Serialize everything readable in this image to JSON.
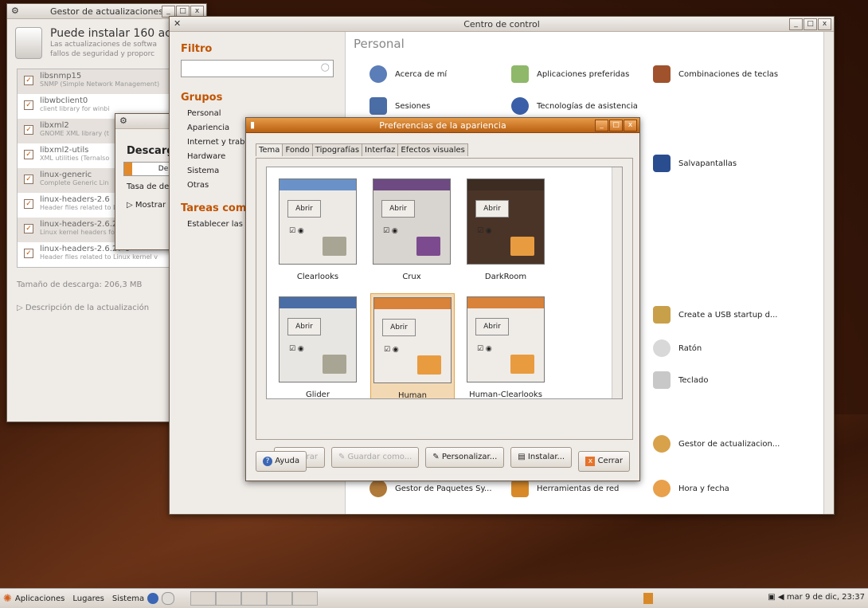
{
  "update_manager": {
    "title": "Gestor de actualizaciones",
    "heading": "Puede instalar 160 ac",
    "subtitle_1": "Las actualizaciones de softwa",
    "subtitle_2": "fallos de seguridad y proporc",
    "packages": [
      {
        "name": "libsnmp15",
        "desc": "SNMP (Simple Network Management)"
      },
      {
        "name": "libwbclient0",
        "desc": "client library for winbi"
      },
      {
        "name": "libxml2",
        "desc": "GNOME XML library (t"
      },
      {
        "name": "libxml2-utils",
        "desc": "XML utilities (Ternalso"
      },
      {
        "name": "linux-generic",
        "desc": "Complete Generic Lin"
      },
      {
        "name": "linux-headers-2.6",
        "desc": "Header files related to Linux kernel"
      },
      {
        "name": "linux-headers-2.6.27-7-gener",
        "desc": "Linux kernel headers for version 2.6"
      },
      {
        "name": "linux-headers-2.6.27-9",
        "desc": "Header files related to Linux kernel v"
      }
    ],
    "download_size": "Tamaño de descarga: 206,3 MB",
    "description_toggle": "Descripción de la actualización"
  },
  "download_dialog": {
    "title": "Descarg",
    "progress_text": "De",
    "progress": 0.1,
    "rate_label": "Tasa de de",
    "show_details": "Mostrar"
  },
  "control_center": {
    "title": "Centro de control",
    "filter_heading": "Filtro",
    "groups_heading": "Grupos",
    "groups": [
      "Personal",
      "Apariencia",
      "Internet y traba",
      "Hardware",
      "Sistema",
      "Otras"
    ],
    "tasks_heading": "Tareas comu",
    "task_1": "Establecer las",
    "section": "Personal",
    "items": {
      "about_me": "Acerca de mí",
      "preferred_apps": "Aplicaciones preferidas",
      "keyboard_shortcuts": "Combinaciones de teclas",
      "sessions": "Sesiones",
      "assistive_tech": "Tecnologías de asistencia",
      "screensaver": "Salvapantallas",
      "usb_startup": "Create a USB startup d...",
      "mouse": "Ratón",
      "keyboard": "Teclado",
      "update_manager": "Gestor de actualizacion...",
      "synaptic": "Gestor de Paquetes Sy...",
      "network_tools": "Herramientas de red",
      "time_date": "Hora y fecha"
    }
  },
  "appearance": {
    "title": "Preferencias de la apariencia",
    "tabs": [
      "Tema",
      "Fondo",
      "Tipografías",
      "Interfaz",
      "Efectos visuales"
    ],
    "themes": [
      {
        "name": "Clearlooks",
        "button": "Abrir",
        "bar": "#6a92c9",
        "folder": "#a9a594",
        "bg": "#edeae6"
      },
      {
        "name": "Crux",
        "button": "Abrir",
        "bar": "#6d4a82",
        "folder": "#7c4b8f",
        "bg": "#d8d4cf"
      },
      {
        "name": "DarkRoom",
        "button": "Abrir",
        "bar": "#3c2c22",
        "folder": "#e99b3f",
        "bg": "#4a3428"
      },
      {
        "name": "Glider",
        "button": "Abrir",
        "bar": "#4a6da6",
        "folder": "#a9a594",
        "bg": "#e8e6e2"
      },
      {
        "name": "Human",
        "button": "Abrir",
        "bar": "#d8823a",
        "folder": "#e99b3f",
        "bg": "#efebe7"
      },
      {
        "name": "Human-Clearlooks",
        "button": "Abrir",
        "bar": "#d8823a",
        "folder": "#e99b3f",
        "bg": "#efebe7"
      }
    ],
    "buttons": {
      "delete": "Borrar",
      "save_as": "Guardar como...",
      "customize": "Personalizar...",
      "install": "Instalar..."
    },
    "help": "Ayuda",
    "close": "Cerrar"
  },
  "panel": {
    "applications": "Aplicaciones",
    "places": "Lugares",
    "system": "Sistema",
    "clock": "mar 9 de dic, 23:37"
  }
}
